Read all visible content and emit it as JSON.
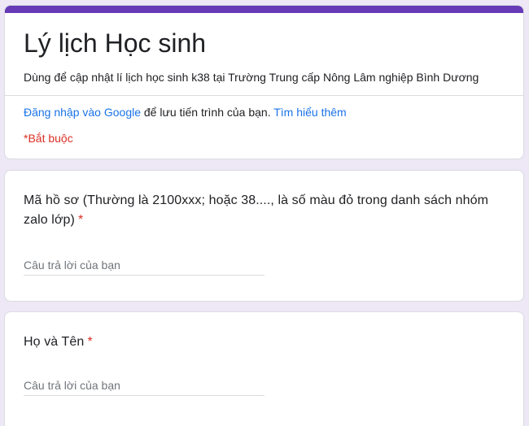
{
  "colors": {
    "accent": "#673ab7",
    "link": "#1a73e8",
    "required": "#d93025",
    "page_background": "#ede7f6"
  },
  "form": {
    "title": "Lý lịch Học sinh",
    "description": "Dùng để cập nhật lí lịch học sinh k38 tại Trường Trung cấp Nông Lâm nghiệp Bình Dương",
    "signin": {
      "link_text": "Đăng nhập vào Google",
      "middle_text": " để lưu tiến trình của bạn. ",
      "learn_more": "Tìm hiểu thêm"
    },
    "required_note": "*Bắt buộc"
  },
  "questions": [
    {
      "title": "Mã hồ sơ (Thường là 2100xxx; hoặc 38...., là số màu đỏ trong danh sách nhóm zalo lớp)",
      "required_mark": "*",
      "placeholder": "Câu trả lời của bạn"
    },
    {
      "title": "Họ và Tên",
      "required_mark": "*",
      "placeholder": "Câu trả lời của bạn"
    }
  ]
}
